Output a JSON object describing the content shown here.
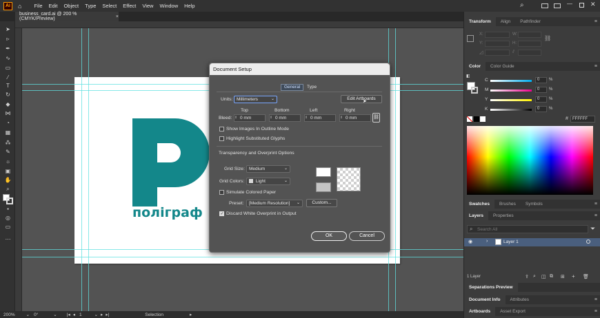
{
  "app": {
    "logo": "Ai",
    "menus": [
      "File",
      "Edit",
      "Object",
      "Type",
      "Select",
      "Effect",
      "View",
      "Window",
      "Help"
    ]
  },
  "document": {
    "tab_title": "business_card.ai @ 200 % (CMYK/Preview)",
    "tab_close": "×"
  },
  "artwork": {
    "logo_text": "поліграф",
    "brand_color": "#13878a"
  },
  "statusbar": {
    "zoom": "200%",
    "rotation": "0°",
    "artboard": "1",
    "tool": "Selection"
  },
  "panels": {
    "top_tabs": [
      "Transform",
      "Align",
      "Pathfinder"
    ],
    "transform": {
      "x_label": "X:",
      "y_label": "Y:",
      "w_label": "W:",
      "h_label": "H:"
    },
    "color_tabs": [
      "Color",
      "Color Guide"
    ],
    "color_sliders": [
      {
        "label": "C",
        "value": "0",
        "unit": "%"
      },
      {
        "label": "M",
        "value": "0",
        "unit": "%"
      },
      {
        "label": "Y",
        "value": "0",
        "unit": "%"
      },
      {
        "label": "K",
        "value": "0",
        "unit": "%"
      }
    ],
    "hex_label": "#",
    "hex_value": "FFFFFF",
    "swatch_tabs": [
      "Swatches",
      "Brushes",
      "Symbols"
    ],
    "layers_tabs": [
      "Layers",
      "Properties"
    ],
    "layers_search_placeholder": "Search All",
    "layer_name": "Layer 1",
    "layer_count": "1 Layer",
    "separations": "Separations Preview",
    "docinfo_tabs": [
      "Document Info",
      "Attributes"
    ],
    "artboard_tabs": [
      "Artboards",
      "Asset Export"
    ]
  },
  "dialog": {
    "title": "Document Setup",
    "tabs": [
      "General",
      "Type"
    ],
    "units_label": "Units:",
    "units_value": "Millimeters",
    "edit_artboards": "Edit Artboards",
    "bleed_label": "Bleed:",
    "bleed": [
      {
        "label": "Top",
        "value": "0 mm"
      },
      {
        "label": "Bottom",
        "value": "0 mm"
      },
      {
        "label": "Left",
        "value": "0 mm"
      },
      {
        "label": "Right",
        "value": "0 mm"
      }
    ],
    "show_images_outline": "Show Images In Outline Mode",
    "highlight_glyphs": "Highlight Substituted Glyphs",
    "transparency_section": "Transparency and Overprint Options",
    "grid_size_label": "Grid Size:",
    "grid_size_value": "Medium",
    "grid_colors_label": "Grid Colors:",
    "grid_colors_value": "Light",
    "simulate_paper": "Simulate Colored Paper",
    "preset_label": "Preset:",
    "preset_value": "[Medium Resolution]",
    "custom_button": "Custom...",
    "discard_overprint": "Discard White Overprint in Output",
    "ok": "OK",
    "cancel": "Cancel"
  }
}
